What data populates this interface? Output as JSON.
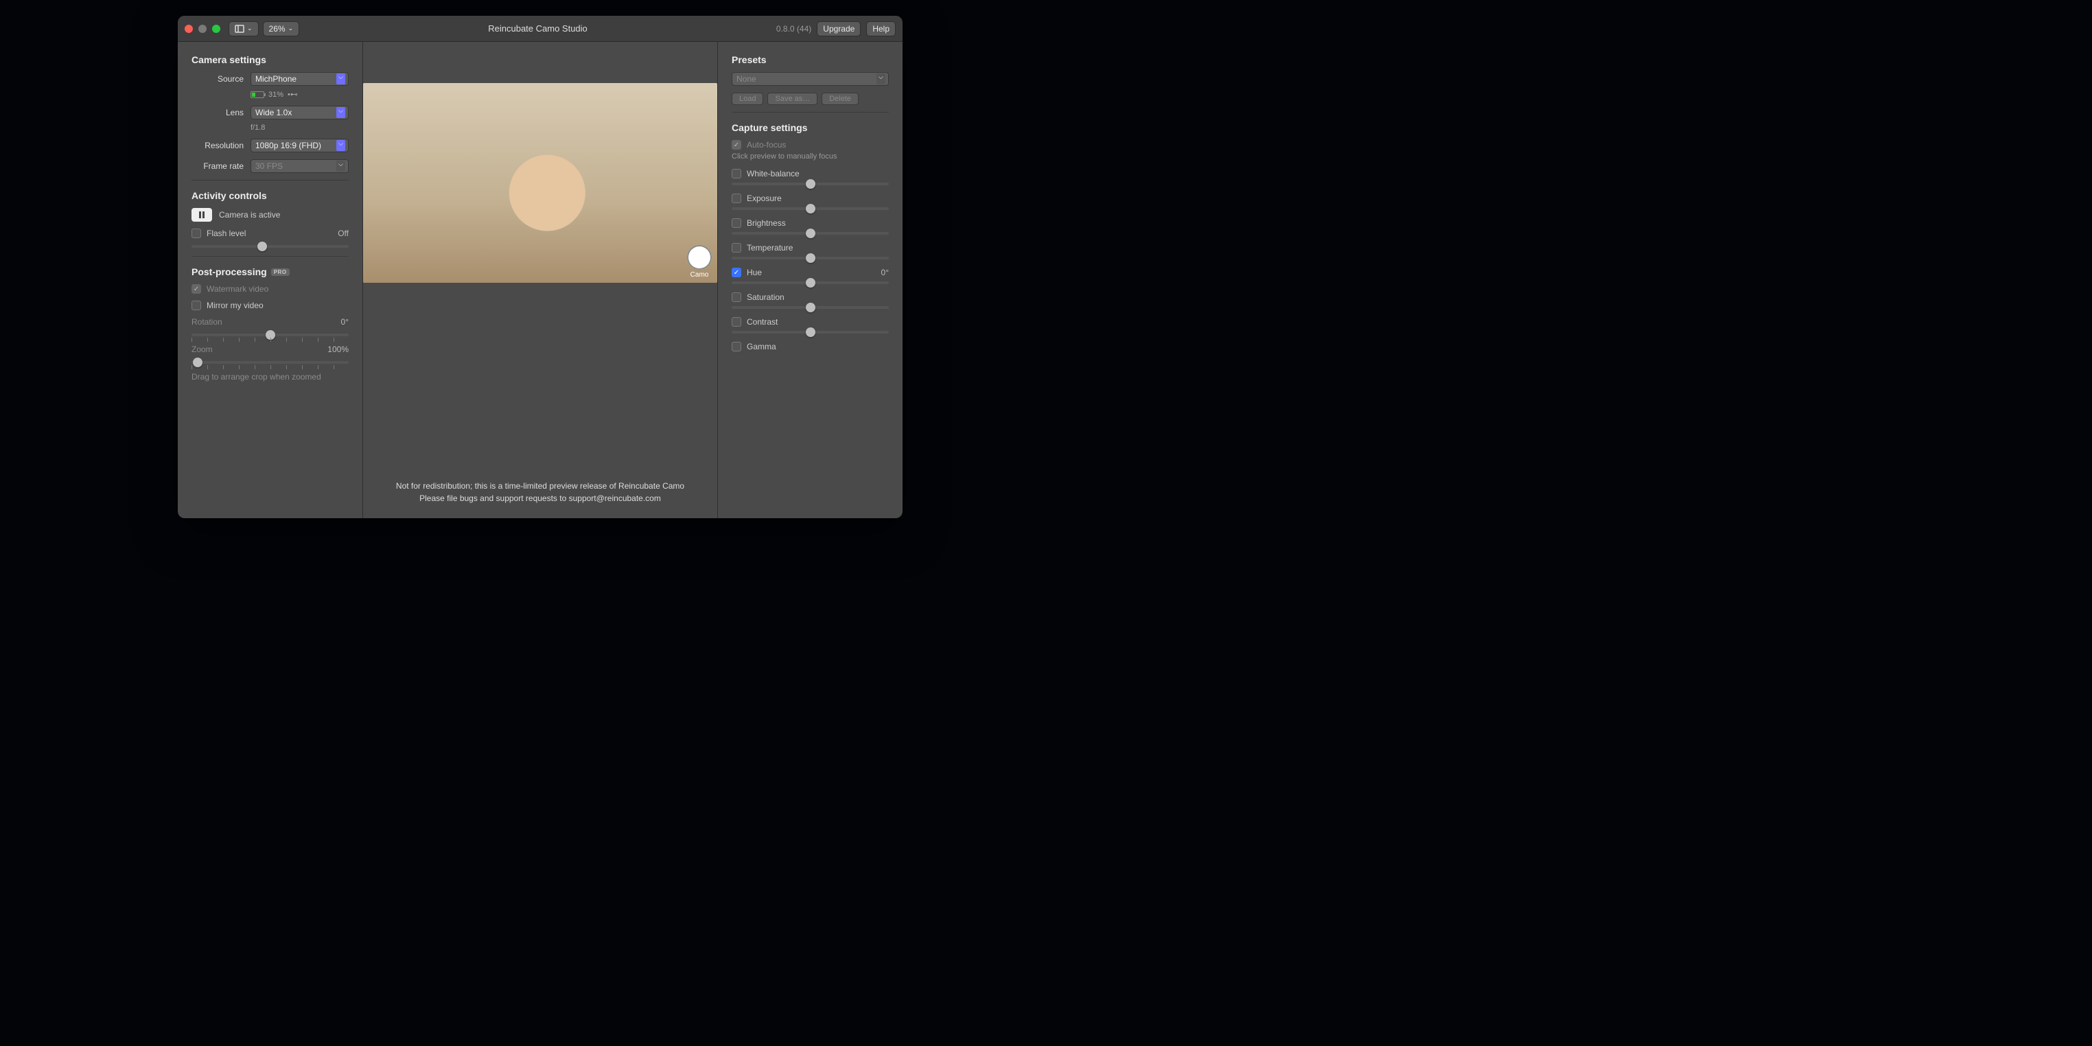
{
  "titlebar": {
    "title": "Reincubate Camo Studio",
    "version": "0.8.0 (44)",
    "upgrade": "Upgrade",
    "help": "Help",
    "zoom_percent": "26%"
  },
  "left": {
    "camera_settings": "Camera settings",
    "source_label": "Source",
    "source_value": "MichPhone",
    "battery_percent": "31%",
    "lens_label": "Lens",
    "lens_value": "Wide 1.0x",
    "aperture": "f/1.8",
    "resolution_label": "Resolution",
    "resolution_value": "1080p 16:9 (FHD)",
    "framerate_label": "Frame rate",
    "framerate_value": "30 FPS",
    "activity_controls": "Activity controls",
    "camera_active": "Camera is active",
    "flash_level": "Flash level",
    "flash_value": "Off",
    "post_processing": "Post-processing",
    "pro_badge": "PRO",
    "watermark": "Watermark video",
    "mirror": "Mirror my video",
    "rotation": "Rotation",
    "rotation_value": "0°",
    "zoom": "Zoom",
    "zoom_value": "100%",
    "drag_hint": "Drag to arrange crop when zoomed"
  },
  "center": {
    "camo_label": "Camo",
    "notice_line1": "Not for redistribution; this is a time-limited preview release of Reincubate Camo",
    "notice_line2": "Please file bugs and support requests to support@reincubate.com"
  },
  "right": {
    "presets": "Presets",
    "preset_value": "None",
    "load": "Load",
    "save_as": "Save as…",
    "delete": "Delete",
    "capture_settings": "Capture settings",
    "auto_focus": "Auto-focus",
    "focus_hint": "Click preview to manually focus",
    "white_balance": "White-balance",
    "exposure": "Exposure",
    "brightness": "Brightness",
    "temperature": "Temperature",
    "hue": "Hue",
    "hue_value": "0°",
    "saturation": "Saturation",
    "contrast": "Contrast",
    "gamma": "Gamma"
  }
}
